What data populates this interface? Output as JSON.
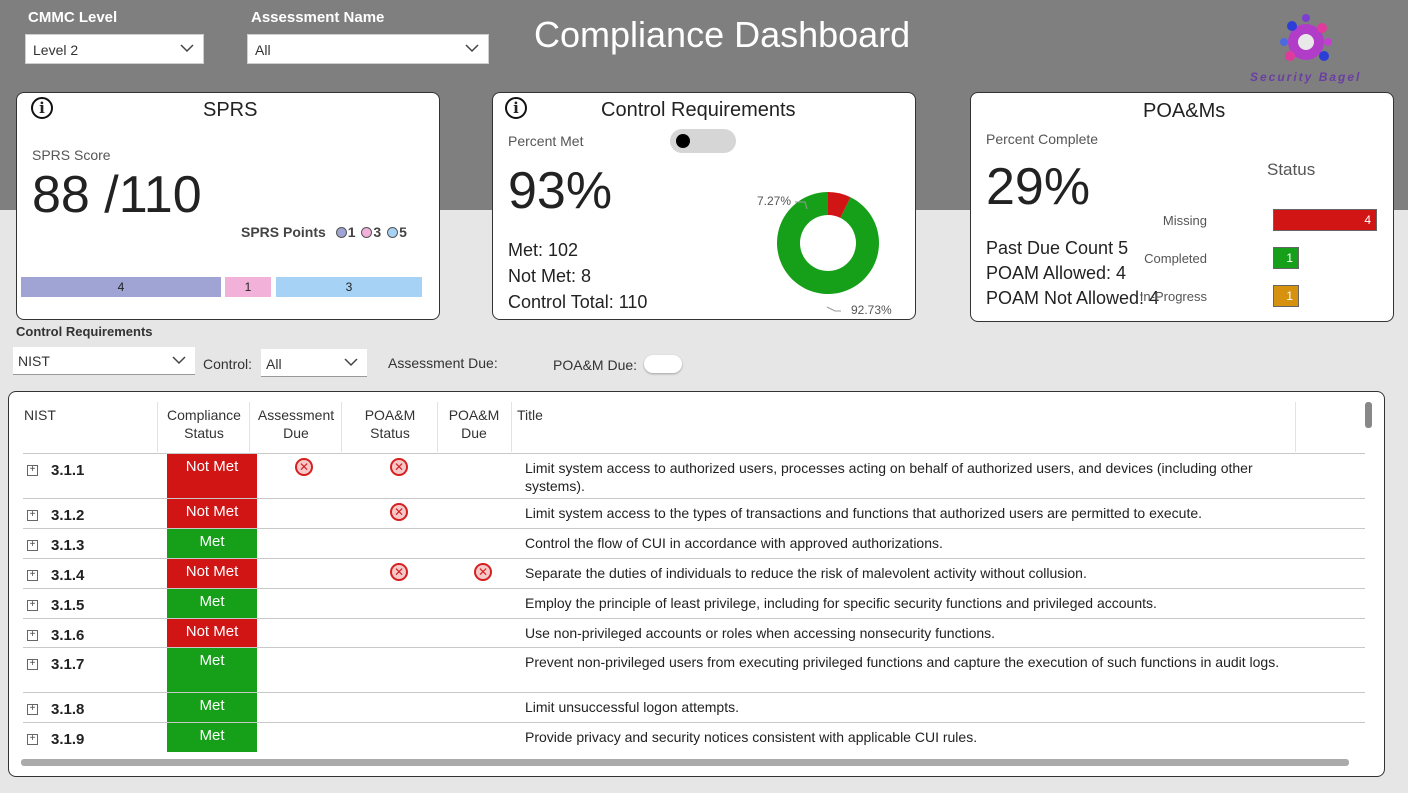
{
  "header": {
    "cmmc_label": "CMMC Level",
    "cmmc_value": "Level 2",
    "assessment_label": "Assessment Name",
    "assessment_value": "All",
    "title": "Compliance Dashboard",
    "logo_text": "Security Bagel"
  },
  "sprs": {
    "title": "SPRS",
    "score_label": "SPRS Score",
    "score": "88 /110",
    "points_label": "SPRS Points",
    "legend": [
      {
        "label": "1",
        "color": "#9fa4d4"
      },
      {
        "label": "3",
        "color": "#f2b1d8"
      },
      {
        "label": "5",
        "color": "#a6d2f5"
      }
    ],
    "segments": [
      {
        "value": "4",
        "color": "#9fa4d4"
      },
      {
        "value": "1",
        "color": "#f2b1d8"
      },
      {
        "value": "3",
        "color": "#a6d2f5"
      }
    ]
  },
  "control": {
    "title": "Control Requirements",
    "percent_label": "Percent Met",
    "percent": "93%",
    "met": "Met: 102",
    "not_met": "Not Met: 8",
    "total": "Control Total: 110",
    "toggle_on": false,
    "donut": {
      "met_pct": 92.73,
      "not_met_pct": 7.27,
      "met_label": "92.73%",
      "not_met_label": "7.27%",
      "met_color": "#16a01a",
      "not_met_color": "#d11414"
    }
  },
  "poam": {
    "title": "POA&Ms",
    "percent_label": "Percent Complete",
    "percent": "29%",
    "past_due": "Past Due Count 5",
    "allowed": "POAM Allowed: 4",
    "not_allowed": "POAM Not Allowed: 4",
    "status_title": "Status",
    "statuses": [
      {
        "label": "Missing",
        "value": "4",
        "color": "#d11414"
      },
      {
        "label": "Completed",
        "value": "1",
        "color": "#16a01a"
      },
      {
        "label": "In-Progress",
        "value": "1",
        "color": "#d6920e"
      }
    ]
  },
  "filters": {
    "section_label": "Control Requirements",
    "framework_value": "NIST",
    "control_label": "Control:",
    "control_value": "All",
    "assessment_due_label": "Assessment Due:",
    "poam_due_label": "POA&M Due:"
  },
  "table": {
    "headers": {
      "nist": "NIST",
      "compliance_1": "Compliance",
      "compliance_2": "Status",
      "assessment_1": "Assessment",
      "assessment_2": "Due",
      "poam_status_1": "POA&M",
      "poam_status_2": "Status",
      "poam_due_1": "POA&M",
      "poam_due_2": "Due",
      "title": "Title"
    },
    "colors": {
      "met": "#16a01a",
      "not_met": "#d11414"
    },
    "rows": [
      {
        "id": "3.1.1",
        "status": "Not Met",
        "assessment_due": true,
        "poam_status": true,
        "poam_due": false,
        "title": "Limit system access to authorized users, processes acting on behalf of authorized users, and devices (including other systems)."
      },
      {
        "id": "3.1.2",
        "status": "Not Met",
        "assessment_due": false,
        "poam_status": true,
        "poam_due": false,
        "title": "Limit system access to the types of transactions and functions that authorized users are permitted to execute."
      },
      {
        "id": "3.1.3",
        "status": "Met",
        "assessment_due": false,
        "poam_status": false,
        "poam_due": false,
        "title": "Control the flow of CUI in accordance with approved authorizations."
      },
      {
        "id": "3.1.4",
        "status": "Not Met",
        "assessment_due": false,
        "poam_status": true,
        "poam_due": true,
        "title": "Separate the duties of individuals to reduce the risk of malevolent activity without collusion."
      },
      {
        "id": "3.1.5",
        "status": "Met",
        "assessment_due": false,
        "poam_status": false,
        "poam_due": false,
        "title": "Employ the principle of least privilege, including for specific security functions and privileged accounts."
      },
      {
        "id": "3.1.6",
        "status": "Not Met",
        "assessment_due": false,
        "poam_status": false,
        "poam_due": false,
        "title": "Use non-privileged accounts or roles when accessing nonsecurity functions."
      },
      {
        "id": "3.1.7",
        "status": "Met",
        "assessment_due": false,
        "poam_status": false,
        "poam_due": false,
        "title": "Prevent non-privileged users from executing privileged functions and capture the execution of such functions in audit logs."
      },
      {
        "id": "3.1.8",
        "status": "Met",
        "assessment_due": false,
        "poam_status": false,
        "poam_due": false,
        "title": "Limit unsuccessful logon attempts."
      },
      {
        "id": "3.1.9",
        "status": "Met",
        "assessment_due": false,
        "poam_status": false,
        "poam_due": false,
        "title": "Provide privacy and security notices consistent with applicable CUI rules."
      }
    ]
  }
}
